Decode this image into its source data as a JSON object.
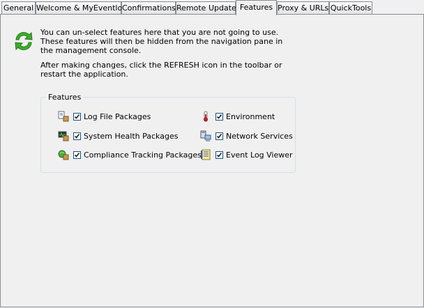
{
  "tabs": [
    {
      "label": "General",
      "active": false
    },
    {
      "label": "Welcome & MyEventlog",
      "active": false
    },
    {
      "label": "Confirmations",
      "active": false
    },
    {
      "label": "Remote Update",
      "active": false
    },
    {
      "label": "Features",
      "active": true
    },
    {
      "label": "Proxy & URLs",
      "active": false
    },
    {
      "label": "QuickTools",
      "active": false
    }
  ],
  "intro_text": "You can un-select features here that you are not going to use. These features will then be hidden from the navigation pane in the management console.",
  "note_text": "After making changes, click the REFRESH icon in the toolbar or restart the application.",
  "features_group": {
    "title": "Features",
    "items": [
      {
        "label": "Log File Packages",
        "checked": true,
        "icon": "log-file-packages-icon"
      },
      {
        "label": "Environment",
        "checked": true,
        "icon": "thermometer-icon"
      },
      {
        "label": "System Health Packages",
        "checked": true,
        "icon": "system-health-icon"
      },
      {
        "label": "Network Services",
        "checked": true,
        "icon": "network-services-icon"
      },
      {
        "label": "Compliance Tracking Packages",
        "checked": true,
        "icon": "compliance-tracking-icon"
      },
      {
        "label": "Event Log Viewer",
        "checked": true,
        "icon": "event-log-viewer-icon"
      }
    ]
  },
  "colors": {
    "refresh_green": "#3cae2c",
    "checkbox_border": "#1c5180",
    "tab_border": "#898c95"
  }
}
